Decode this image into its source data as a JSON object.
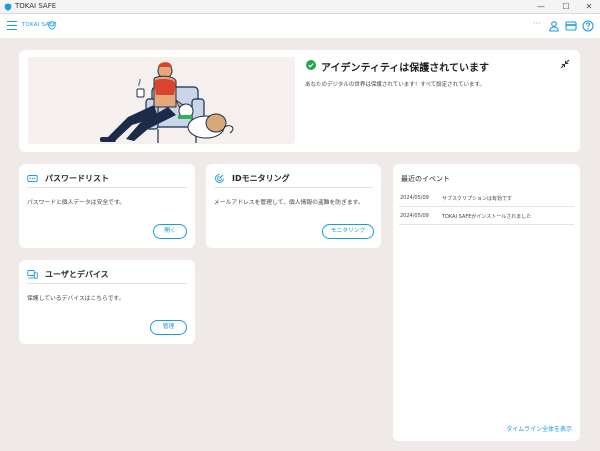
{
  "window": {
    "title": "TOKAI SAFE",
    "minimize_glyph": "—",
    "maximize_glyph": "☐",
    "close_glyph": "✕"
  },
  "header": {
    "brand": "TOKAI SAFE",
    "more_glyph": "···"
  },
  "hero": {
    "title": "アイデンティティは保護されています",
    "description": "あなたのデジタルの世界は保護されています！すべて設定されています。"
  },
  "password_card": {
    "title": "パスワードリスト",
    "description": "パスワードと個人データは安全です。",
    "button": "開く"
  },
  "id_card": {
    "title": "IDモニタリング",
    "description": "メールアドレスを管理して、個人情報の盗難を防ぎます。",
    "button": "モニタリング"
  },
  "user_card": {
    "title": "ユーザとデバイス",
    "description": "保護しているデバイスはこちらです。",
    "button": "管理"
  },
  "events": {
    "title": "最近のイベント",
    "items": [
      {
        "date": "2024/05/09",
        "text": "サブスクリプションは有効です"
      },
      {
        "date": "2024/05/09",
        "text": "TOKAI SAFEがインストールされました"
      }
    ],
    "timeline_link": "タイムライン全体を表示"
  },
  "colors": {
    "accent": "#1a9be6",
    "success": "#1fa54a",
    "background": "#efeae8"
  }
}
